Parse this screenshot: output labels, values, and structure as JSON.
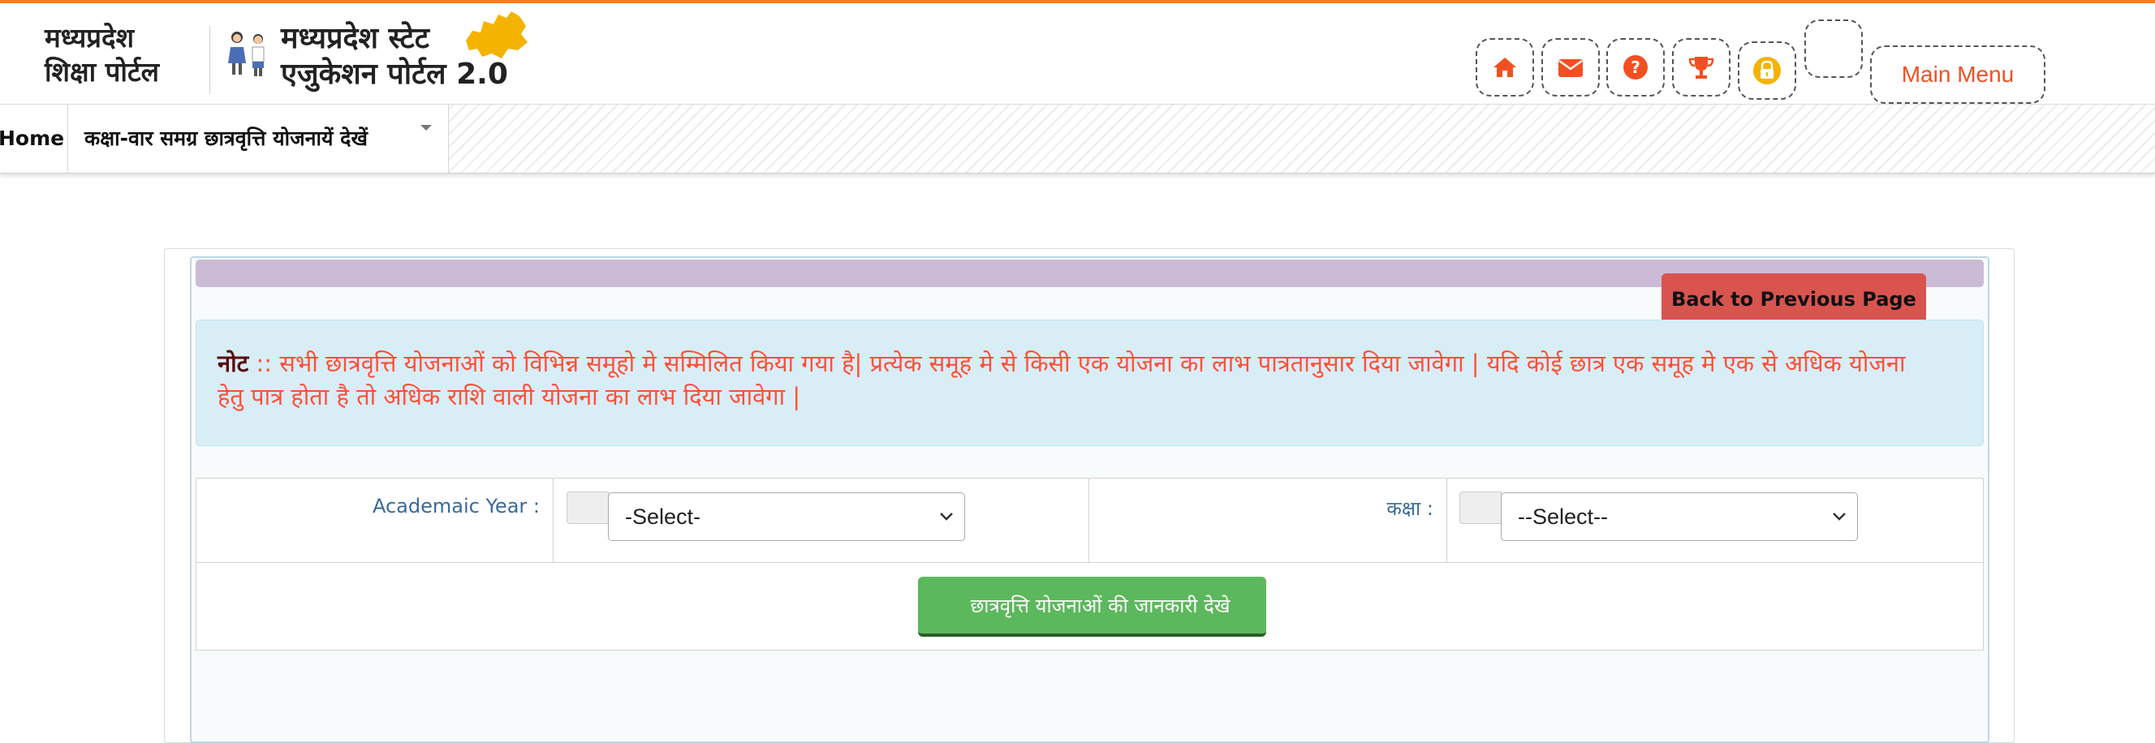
{
  "header": {
    "logo_left_line1": "मध्यप्रदेश",
    "logo_left_line2": "शिक्षा पोर्टल",
    "logo_right_line1": "मध्यप्रदेश स्टेट",
    "logo_right_line2": "एजुकेशन पोर्टल 2.0",
    "icons": [
      "home-icon",
      "envelope-icon",
      "question-circle-icon",
      "trophy-icon",
      "lock-icon",
      "blank-icon"
    ],
    "main_menu_label": "Main Menu",
    "accent_color": "#f25022"
  },
  "nav": {
    "home_label": "Home",
    "item_label": "कक्षा-वार समग्र छात्रवृत्ति योजनायें देखें"
  },
  "panel": {
    "back_button_label": "Back to Previous Page",
    "note_label": "नोट",
    "note_text": " :: सभी छात्रवृत्ति योजनाओं को विभिन्न समूहो मे सम्मिलित किया गया है| प्रत्येक समूह मे से किसी एक योजना का लाभ पात्रतानुसार दिया जावेगा | यदि कोई छात्र एक समूह मे एक से अधिक योजना हेतु पात्र होता है तो अधिक राशि वाली योजना का लाभ दिया जावेगा |"
  },
  "form": {
    "academic_year_label": "Academaic Year :",
    "academic_year_value": "-Select-",
    "class_label": "कक्षा :",
    "class_value": "--Select--",
    "submit_label": "छात्रवृत्ति योजनाओं की जानकारी देखे"
  },
  "colors": {
    "back_button": "#d9534f",
    "submit_button": "#5cb85c",
    "note_background": "#d9edf7",
    "note_text": "#ff4f36"
  }
}
